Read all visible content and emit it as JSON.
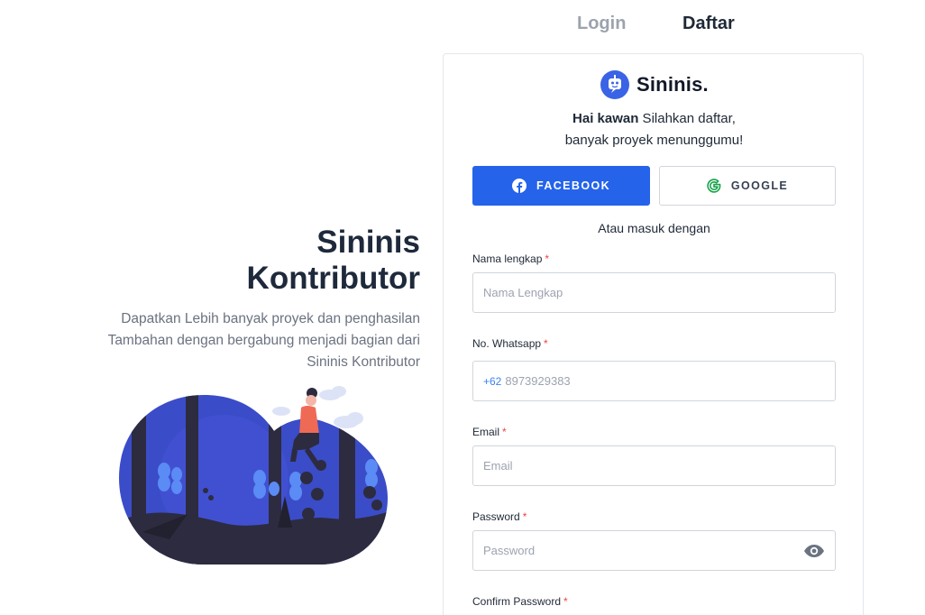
{
  "tabs": {
    "login": "Login",
    "daftar": "Daftar"
  },
  "hero": {
    "title_line1": "Sininis",
    "title_line2": "Kontributor",
    "sub_line1": "Dapatkan Lebih banyak proyek dan penghasilan",
    "sub_line2": "Tambahan dengan bergabung menjadi bagian dari",
    "sub_line3": "Sininis Kontributor"
  },
  "card": {
    "brand_name": "Sininis.",
    "welcome_bold": "Hai kawan",
    "welcome_rest": " Silahkan daftar,",
    "welcome_line2": "banyak proyek menunggumu!",
    "facebook_label": "FACEBOOK",
    "google_label": "GOOGLE",
    "divider_text": "Atau masuk dengan",
    "required_mark": "*",
    "fields": {
      "name": {
        "label": "Nama lengkap",
        "placeholder": "Nama Lengkap",
        "value": ""
      },
      "whatsapp": {
        "label": "No. Whatsapp",
        "prefix": "+62",
        "placeholder": "8973929383",
        "value": ""
      },
      "email": {
        "label": "Email",
        "placeholder": "Email",
        "value": ""
      },
      "password": {
        "label": "Password",
        "placeholder": "Password",
        "value": ""
      },
      "confirm_password": {
        "label": "Confirm Password"
      }
    }
  },
  "icons": {
    "brand_logo": "robot-logo-icon",
    "facebook": "facebook-icon",
    "google": "google-icon",
    "password_toggle": "eye-icon"
  },
  "colors": {
    "primary": "#2563eb",
    "title": "#1e293b",
    "muted": "#6b7280",
    "required": "#ef4444",
    "google_green": "#16a34a",
    "illustration_blue": "#3b4cc8",
    "illustration_dark": "#2d2b3f"
  }
}
